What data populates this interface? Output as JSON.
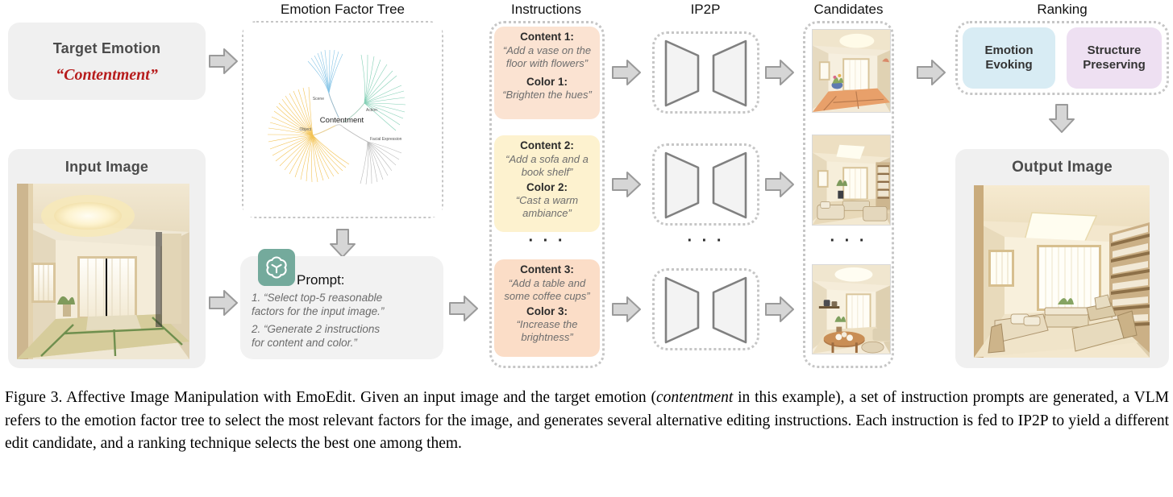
{
  "column_titles": {
    "tree": "Emotion Factor Tree",
    "instructions": "Instructions",
    "ip2p": "IP2P",
    "candidates": "Candidates",
    "ranking": "Ranking"
  },
  "target_emotion": {
    "header": "Target Emotion",
    "value": "“Contentment”"
  },
  "input_image": {
    "header": "Input Image"
  },
  "output_image": {
    "header": "Output Image"
  },
  "prompt": {
    "title": "Prompt:",
    "icon": "openai-logo-icon",
    "lines": [
      "1. “Select top-5 reasonable",
      "factors for the input image.”",
      "2. “Generate 2 instructions",
      "for content and color.”"
    ]
  },
  "instructions": [
    {
      "content_label": "Content 1:",
      "content_text": "“Add a vase on the floor with flowers”",
      "color_label": "Color 1:",
      "color_text": "“Brighten the hues”",
      "bg": "#fbe3d2"
    },
    {
      "content_label": "Content 2:",
      "content_text": "“Add a sofa and a book shelf”",
      "color_label": "Color 2:",
      "color_text": "“Cast a warm ambiance”",
      "bg": "#fdf2cf"
    },
    {
      "content_label": "Content 3:",
      "content_text": "“Add a table and some coffee cups”",
      "color_label": "Color 3:",
      "color_text": "“Increase the brightness”",
      "bg": "#fbddc7"
    }
  ],
  "ellipsis": "· · ·",
  "ranking": {
    "criteria": [
      {
        "label": "Emotion Evoking",
        "bg": "#d8ecf4"
      },
      {
        "label": "Structure Preserving",
        "bg": "#eee0f2"
      }
    ]
  },
  "tree": {
    "center": "Contentment",
    "branches": [
      {
        "name": "Scene",
        "color": "#5aaede"
      },
      {
        "name": "Action",
        "color": "#5fc2a0"
      },
      {
        "name": "Object",
        "color": "#f0b429"
      },
      {
        "name": "Facial Expression",
        "color": "#9a9a9a"
      }
    ]
  },
  "caption": {
    "prefix": "Figure 3. Affective Image Manipulation with EmoEdit. Given an input image and the target emotion (",
    "emphasis": "contentment",
    "suffix": " in this example), a set of instruction prompts are generated, a VLM refers to the emotion factor tree to select the most relevant factors for the image, and generates several alternative editing instructions. Each instruction is fed to IP2P to yield a different edit candidate, and a ranking technique selects the best one among them."
  }
}
